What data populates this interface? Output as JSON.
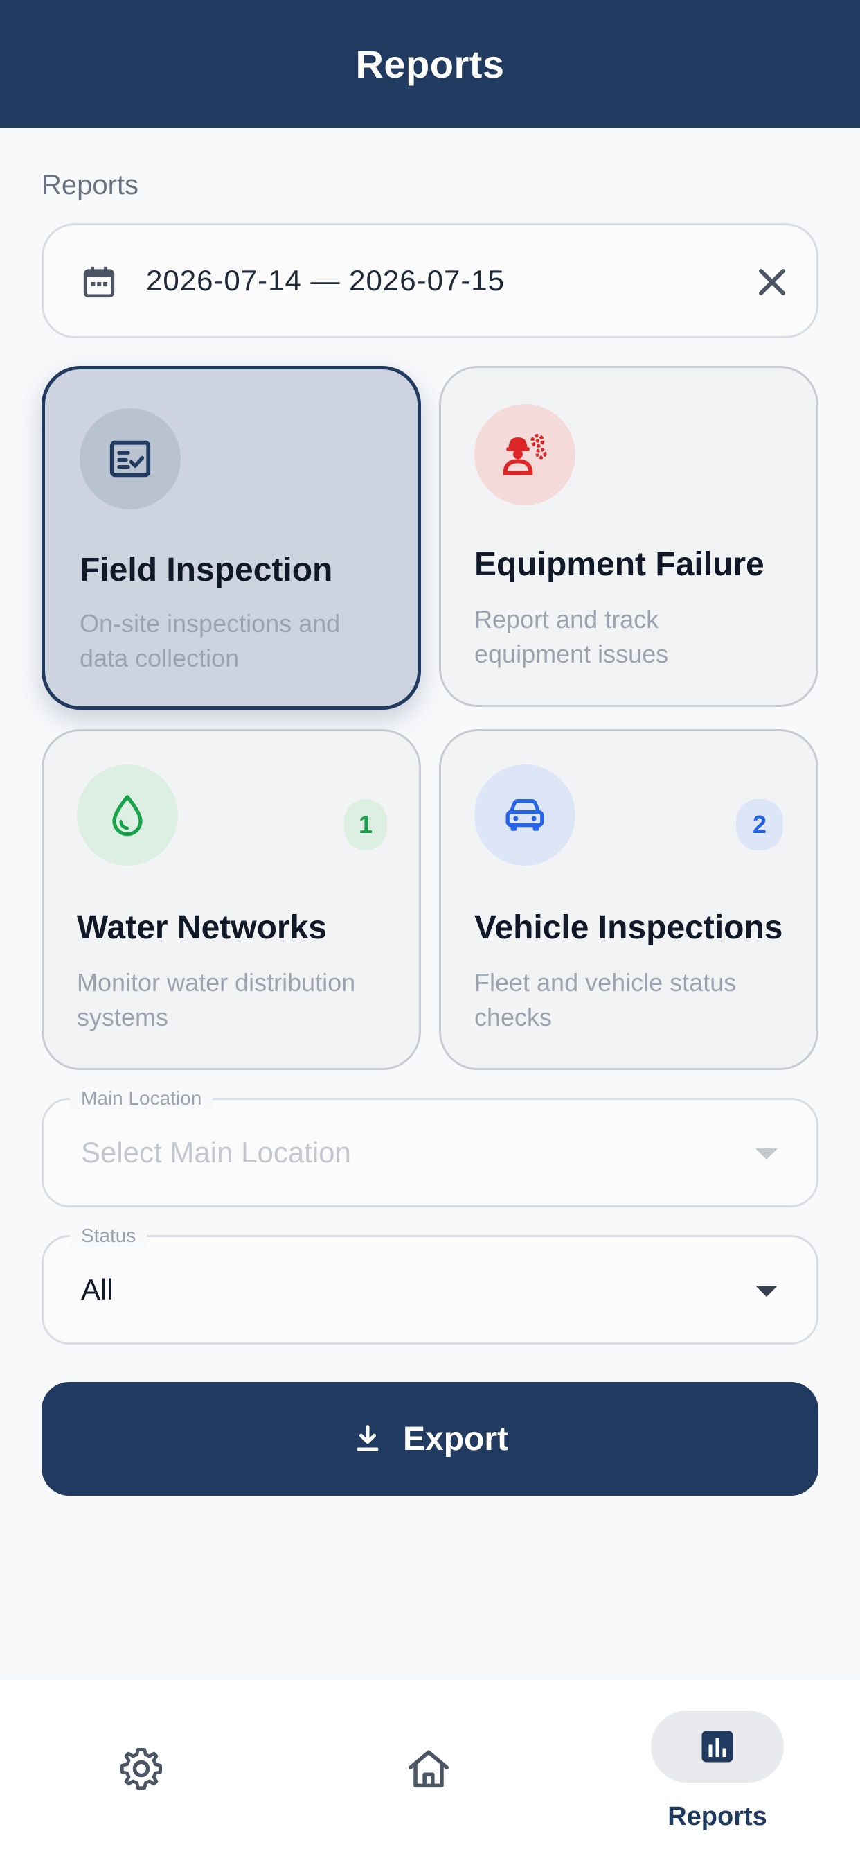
{
  "header": {
    "title": "Reports"
  },
  "section_label": "Reports",
  "date_range": {
    "value": "2026-07-14 — 2026-07-15",
    "icon": "calendar-icon",
    "clear_icon": "close-icon"
  },
  "cards": [
    {
      "title": "Field Inspection",
      "description": "On-site inspections and data collection",
      "icon": "checklist-icon",
      "selected": true,
      "badge": null,
      "accent": "#213a5f"
    },
    {
      "title": "Equipment Failure",
      "description": "Report and track equipment issues",
      "icon": "worker-gears-icon",
      "selected": false,
      "badge": null,
      "accent": "#dc2626"
    },
    {
      "title": "Water Networks",
      "description": "Monitor water distribution systems",
      "icon": "water-drop-icon",
      "selected": false,
      "badge": "1",
      "accent": "#16a34a"
    },
    {
      "title": "Vehicle Inspections",
      "description": "Fleet and vehicle status checks",
      "icon": "car-icon",
      "selected": false,
      "badge": "2",
      "accent": "#2563eb"
    }
  ],
  "main_location": {
    "label": "Main Location",
    "placeholder": "Select Main Location"
  },
  "status": {
    "label": "Status",
    "value": "All"
  },
  "export": {
    "label": "Export",
    "icon": "download-icon"
  },
  "bottom_nav": [
    {
      "id": "settings",
      "icon": "gear-icon",
      "label": ""
    },
    {
      "id": "home",
      "icon": "home-icon",
      "label": ""
    },
    {
      "id": "reports",
      "icon": "bar-chart-icon",
      "label": "Reports",
      "active": true
    }
  ],
  "colors": {
    "primary": "#213a5f",
    "equipment_red": "#dc2626",
    "water_green": "#16a34a",
    "vehicle_blue": "#2563eb"
  }
}
